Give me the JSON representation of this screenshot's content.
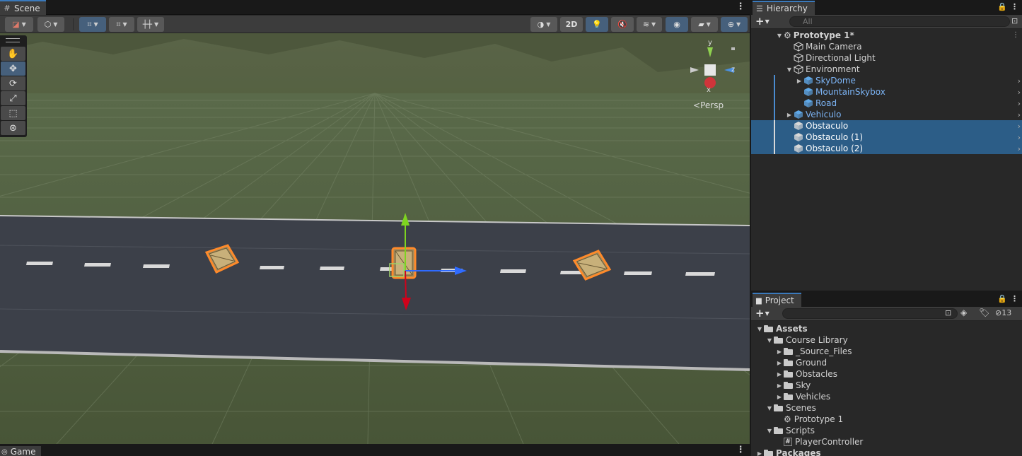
{
  "scene": {
    "tab_label": "Scene",
    "toolbar": {
      "two_d_label": "2D"
    },
    "gizmo": {
      "axis_y": "y",
      "axis_x": "x",
      "axis_z": "z",
      "projection": "Persp"
    }
  },
  "game": {
    "tab_label": "Game"
  },
  "hierarchy": {
    "tab_label": "Hierarchy",
    "search_placeholder": "All",
    "items": [
      {
        "label": "Prototype 1*",
        "depth": 0,
        "kind": "scene",
        "expanded": true
      },
      {
        "label": "Main Camera",
        "depth": 1,
        "kind": "object"
      },
      {
        "label": "Directional Light",
        "depth": 1,
        "kind": "object"
      },
      {
        "label": "Environment",
        "depth": 1,
        "kind": "object",
        "expanded": true
      },
      {
        "label": "SkyDome",
        "depth": 2,
        "kind": "prefab",
        "collapsed": true
      },
      {
        "label": "MountainSkybox",
        "depth": 2,
        "kind": "prefab"
      },
      {
        "label": "Road",
        "depth": 2,
        "kind": "prefab"
      },
      {
        "label": "Vehiculo",
        "depth": 1,
        "kind": "prefab",
        "collapsed": true
      },
      {
        "label": "Obstaculo",
        "depth": 1,
        "kind": "object",
        "selected": true
      },
      {
        "label": "Obstaculo (1)",
        "depth": 1,
        "kind": "object",
        "selected": true
      },
      {
        "label": "Obstaculo (2)",
        "depth": 1,
        "kind": "object",
        "selected": true
      }
    ]
  },
  "project": {
    "tab_label": "Project",
    "search_placeholder": "",
    "hidden_count": "13",
    "items": [
      {
        "label": "Assets",
        "depth": 0,
        "kind": "folder",
        "expanded": true,
        "bold": true
      },
      {
        "label": "Course Library",
        "depth": 1,
        "kind": "folder",
        "expanded": true
      },
      {
        "label": "_Source_Files",
        "depth": 2,
        "kind": "folder",
        "collapsed": true
      },
      {
        "label": "Ground",
        "depth": 2,
        "kind": "folder",
        "collapsed": true
      },
      {
        "label": "Obstacles",
        "depth": 2,
        "kind": "folder",
        "collapsed": true
      },
      {
        "label": "Sky",
        "depth": 2,
        "kind": "folder",
        "collapsed": true
      },
      {
        "label": "Vehicles",
        "depth": 2,
        "kind": "folder",
        "collapsed": true
      },
      {
        "label": "Scenes",
        "depth": 1,
        "kind": "folder",
        "expanded": true
      },
      {
        "label": "Prototype 1",
        "depth": 2,
        "kind": "scene"
      },
      {
        "label": "Scripts",
        "depth": 1,
        "kind": "folder",
        "expanded": true
      },
      {
        "label": "PlayerController",
        "depth": 2,
        "kind": "script"
      },
      {
        "label": "Packages",
        "depth": 0,
        "kind": "folder",
        "collapsed": true,
        "bold": true
      }
    ]
  },
  "colors": {
    "selection": "#2c5d87",
    "prefab_text": "#7cb4f5",
    "accent": "#3a79bb",
    "ground": "#4e5a3f",
    "road": "#3b3f48"
  }
}
